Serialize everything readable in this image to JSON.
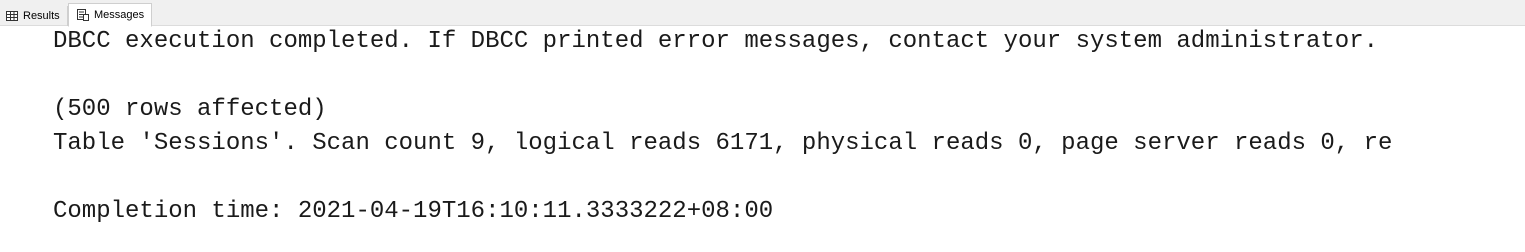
{
  "tabs": {
    "results": {
      "label": "Results",
      "icon": "grid-icon"
    },
    "messages": {
      "label": "Messages",
      "icon": "messages-icon"
    }
  },
  "messages": {
    "line1": "DBCC execution completed. If DBCC printed error messages, contact your system administrator.",
    "line2": "(500 rows affected)",
    "line3": "Table 'Sessions'. Scan count 9, logical reads 6171, physical reads 0, page server reads 0, re",
    "line4": "Completion time: 2021-04-19T16:10:11.3333222+08:00"
  }
}
